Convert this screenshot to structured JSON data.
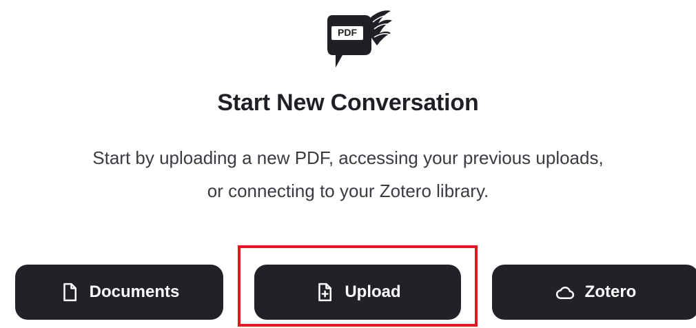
{
  "logo": {
    "badge_text": "PDF",
    "icon": "pdf-chat-logo-icon"
  },
  "title": "Start New Conversation",
  "subtitle": {
    "line1": "Start by uploading a new PDF, accessing your previous uploads,",
    "line2": "or connecting to your Zotero library."
  },
  "buttons": {
    "documents": {
      "label": "Documents",
      "icon": "document-icon"
    },
    "upload": {
      "label": "Upload",
      "icon": "file-plus-icon"
    },
    "zotero": {
      "label": "Zotero",
      "icon": "cloud-icon"
    }
  },
  "colors": {
    "button_bg": "#212227",
    "button_text": "#ffffff",
    "highlight": "#e8141e",
    "title": "#1f2026",
    "subtitle": "#3a3b42"
  }
}
